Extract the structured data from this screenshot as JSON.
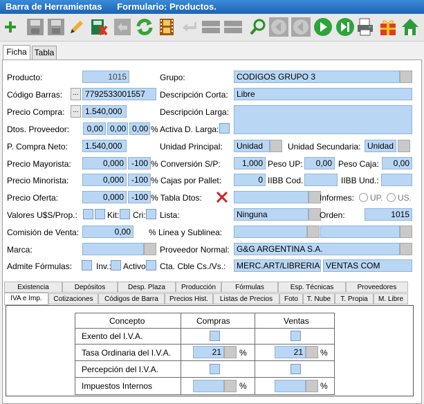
{
  "window": {
    "title": "Barra de Herramientas",
    "subtitle": "Formulario: Productos."
  },
  "toolbar": {
    "buttons": [
      "add",
      "save",
      "save-as",
      "edit",
      "delete",
      "undo",
      "refresh",
      "film",
      "back",
      "list",
      "list2",
      "search",
      "prev",
      "prev2",
      "play",
      "next",
      "print",
      "gift",
      "home"
    ]
  },
  "tabs": {
    "ficha": "Ficha",
    "tabla": "Tabla"
  },
  "form": {
    "producto_label": "Producto:",
    "producto_value": "1015",
    "grupo_label": "Grupo:",
    "grupo_value": "CODIGOS GRUPO 3",
    "codigo_barras_label": "Código Barras:",
    "codigo_barras_value": "7792533001557",
    "desc_corta_label": "Descripción Corta:",
    "desc_corta_value": "Libre",
    "precio_compra_label": "Precio Compra:",
    "precio_compra_value": "1.540,000",
    "desc_larga_label": "Descripción Larga:",
    "dtos_proveedor_label": "Dtos. Proveedor:",
    "dto1": "0,00",
    "dto2": "0,00",
    "dto3": "0,00",
    "pct": "%",
    "activa_d_larga_label": "Activa D. Larga:",
    "p_compra_neto_label": "P. Compra Neto:",
    "p_compra_neto_value": "1.540,000",
    "unidad_principal_label": "Unidad Principal:",
    "unidad_principal_value": "Unidad",
    "unidad_secundaria_label": "Unidad Secundaria:",
    "unidad_secundaria_value": "Unidad",
    "precio_mayorista_label": "Precio Mayorista:",
    "precio_mayorista_value": "0,000",
    "precio_mayorista_pct": "-100",
    "conversion_label": "% Conversión S/P:",
    "conversion_value": "1,000",
    "peso_up_label": "Peso UP:",
    "peso_up_value": "0,00",
    "peso_caja_label": "Peso Caja:",
    "peso_caja_value": "0,00",
    "precio_minorista_label": "Precio Minorista:",
    "precio_minorista_value": "0,000",
    "precio_minorista_pct": "-100",
    "cajas_pallet_label": "% Cajas por Pallet:",
    "cajas_pallet_value": "0",
    "iibb_cod_label": "IIBB Cod.",
    "iibb_und_label": "IIBB Und.:",
    "precio_oferta_label": "Precio Oferta:",
    "precio_oferta_value": "0,000",
    "precio_oferta_pct": "-100",
    "tabla_dtos_label": "% Tabla Dtos:",
    "informes_label": "Informes:",
    "informes_up": "UP.",
    "informes_us": "US.",
    "valores_label": "Valores U$S/Prop.:",
    "kit_label": "Kit:",
    "cri_label": "Cri:",
    "lista_label": "Lista:",
    "lista_value": "Ninguna",
    "orden_label": "Orden:",
    "orden_value": "1015",
    "comision_label": "Comisión de Venta:",
    "comision_value": "0,00",
    "linea_label": "% Linea y Sublinea:",
    "marca_label": "Marca:",
    "proveedor_label": "Proveedor Normal:",
    "proveedor_value": "G&G ARGENTINA S.A.",
    "admite_label": "Admite Fórmulas:",
    "inv_label": "Inv.:",
    "activo_label": "Activo",
    "cta_label": "Cta. Cble Cs./Vs.:",
    "cta_value1": "MERC.ART/LIBRERIA",
    "cta_value2": "VENTAS COM"
  },
  "bottom_tabs": {
    "row1": [
      "Existencia",
      "Depósitos",
      "Desp. Plaza",
      "Producción",
      "Fórmulas",
      "Esp. Técnicas",
      "Proveedores"
    ],
    "row2": [
      "IVA e Imp.",
      "Cotizaciones",
      "Códigos de Barra",
      "Precios Hist.",
      "Listas de Precios",
      "Foto",
      "T. Nube",
      "T. Propia",
      "M. Libre"
    ]
  },
  "iva_table": {
    "headers": [
      "Concepto",
      "Compras",
      "Ventas"
    ],
    "rows": [
      {
        "concepto": "Exento del I.V.A."
      },
      {
        "concepto": "Tasa Ordinaria del I.V.A.",
        "compras": "21",
        "ventas": "21",
        "unit": "%"
      },
      {
        "concepto": "Percepción del I.V.A."
      },
      {
        "concepto": "Impuestos Internos",
        "unit": "%"
      }
    ]
  },
  "colors": {
    "field": "#b9d7f5",
    "title": "#1c62b5"
  }
}
